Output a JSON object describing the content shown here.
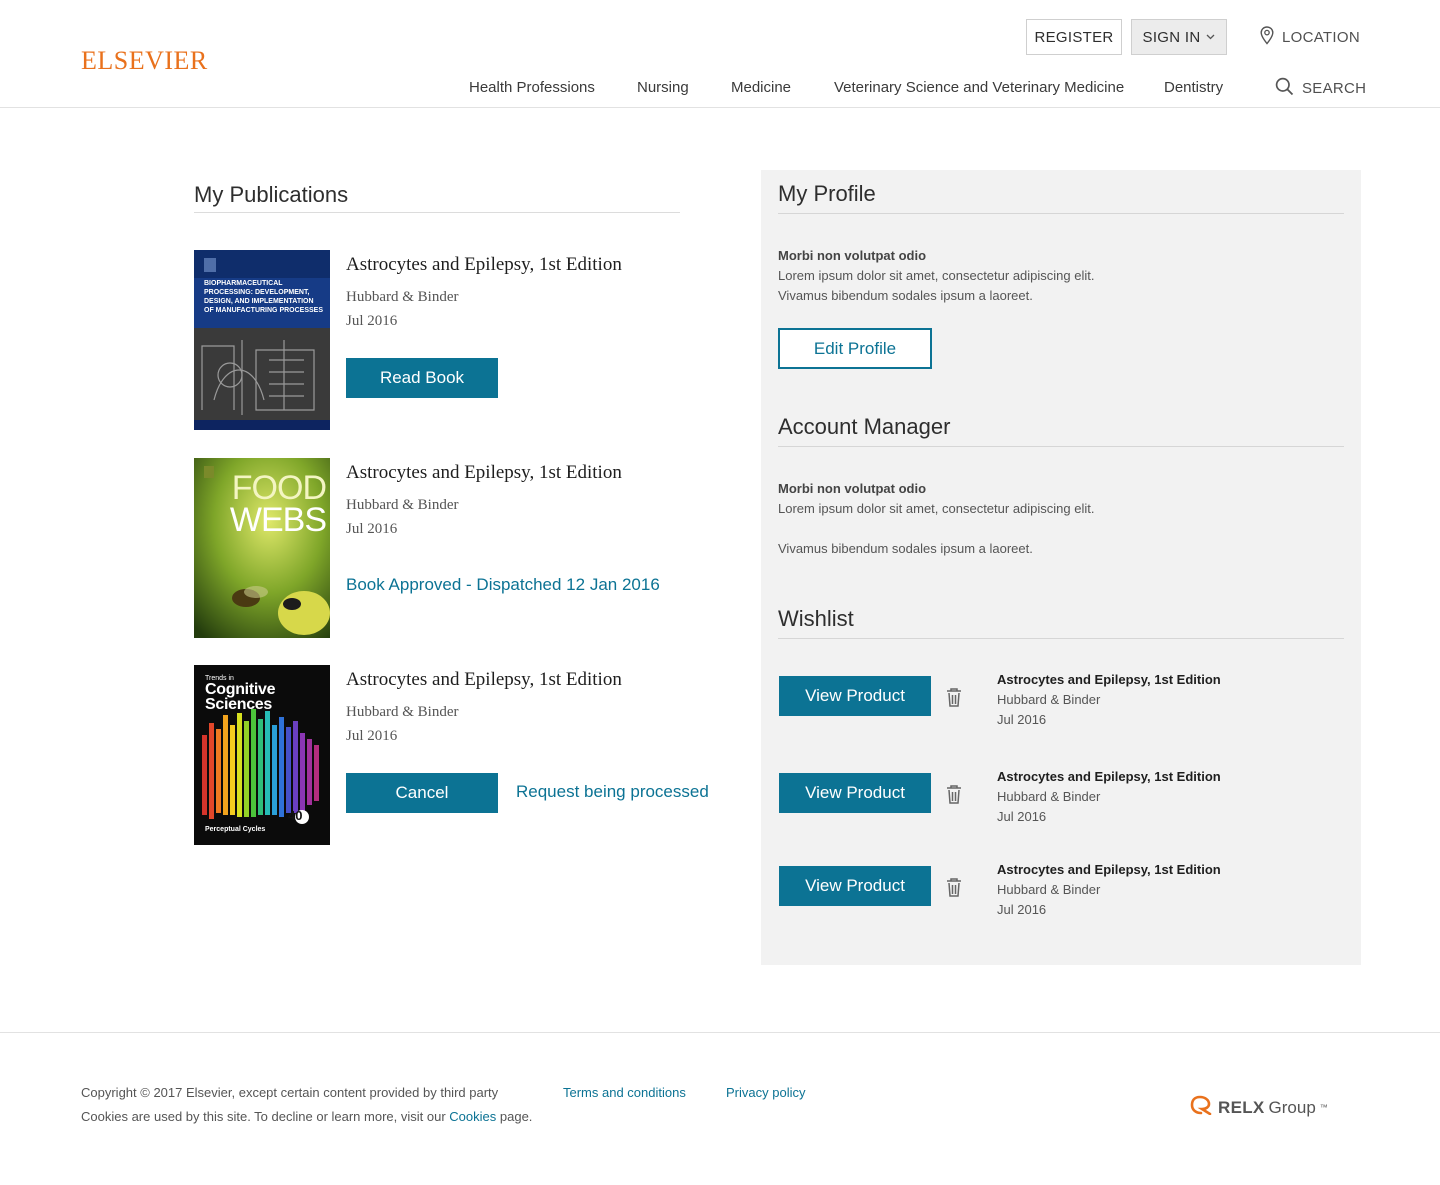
{
  "header": {
    "logo": "ELSEVIER",
    "register_label": "REGISTER",
    "signin_label": "SIGN IN",
    "location_label": "LOCATION",
    "search_label": "SEARCH",
    "nav": [
      "Health Professions",
      "Nursing",
      "Medicine",
      "Veterinary Science and Veterinary Medicine",
      "Dentistry"
    ]
  },
  "publications": {
    "title": "My Publications",
    "items": [
      {
        "title": "Astrocytes and Epilepsy, 1st Edition",
        "author": "Hubbard & Binder",
        "date": "Jul 2016",
        "action_label": "Read Book",
        "cover_text": "BIOPHARMACEUTICAL PROCESSING: DEVELOPMENT, DESIGN, AND IMPLEMENTATION OF MANUFACTURING PROCESSES"
      },
      {
        "title": "Astrocytes and Epilepsy, 1st Edition",
        "author": "Hubbard & Binder",
        "date": "Jul 2016",
        "status_label": "Book Approved - Dispatched 12 Jan 2016",
        "cover_text_1": "FOOD",
        "cover_text_2": "WEBS"
      },
      {
        "title": "Astrocytes and Epilepsy, 1st Edition",
        "author": "Hubbard & Binder",
        "date": "Jul 2016",
        "action_label": "Cancel",
        "status_label": "Request being processed",
        "cover_text_small": "Trends in",
        "cover_text_1": "Cognitive",
        "cover_text_2": "Sciences",
        "cover_text_3": "Perceptual Cycles",
        "cover_text_4": "40"
      }
    ]
  },
  "profile": {
    "title": "My Profile",
    "bold": "Morbi non volutpat odio",
    "line1": "Lorem ipsum dolor sit amet, consectetur adipiscing elit.",
    "line2": "Vivamus bibendum sodales ipsum a laoreet.",
    "edit_label": "Edit Profile"
  },
  "account_manager": {
    "title": "Account Manager",
    "bold": "Morbi non volutpat odio",
    "line1": "Lorem ipsum dolor sit amet, consectetur adipiscing elit.",
    "line2": "Vivamus bibendum sodales ipsum a laoreet."
  },
  "wishlist": {
    "title": "Wishlist",
    "items": [
      {
        "button_label": "View Product",
        "title": "Astrocytes and Epilepsy, 1st Edition",
        "author": "Hubbard & Binder",
        "date": "Jul 2016"
      },
      {
        "button_label": "View Product",
        "title": "Astrocytes and Epilepsy, 1st Edition",
        "author": "Hubbard & Binder",
        "date": "Jul 2016"
      },
      {
        "button_label": "View Product",
        "title": "Astrocytes and Epilepsy, 1st Edition",
        "author": "Hubbard & Binder",
        "date": "Jul 2016"
      }
    ]
  },
  "footer": {
    "copyright": "Copyright © 2017 Elsevier, except certain content provided by third party",
    "terms_label": "Terms and conditions",
    "privacy_label": "Privacy policy",
    "cookies_prefix": "Cookies are used by this site. To decline or learn more, visit our",
    "cookies_link": "Cookies",
    "cookies_suffix": "page.",
    "relx_brand": "RELX",
    "relx_group": "Group",
    "relx_tm": "™"
  },
  "colors": {
    "accent": "#0c7394",
    "brand": "#e9711c",
    "panel_bg": "#f2f2f2"
  }
}
